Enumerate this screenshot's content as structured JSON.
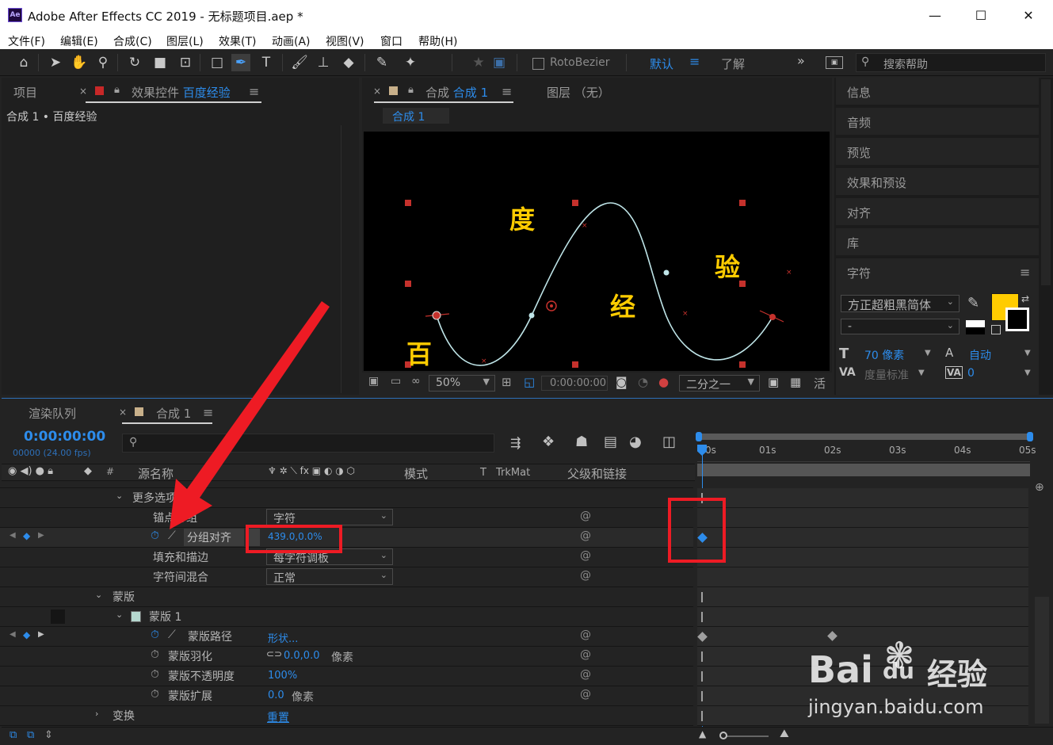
{
  "window": {
    "title": "Adobe After Effects CC 2019 - 无标题项目.aep *",
    "app_badge": "Ae",
    "minimize": "—",
    "maximize": "☐",
    "close": "✕"
  },
  "menu": [
    "文件(F)",
    "编辑(E)",
    "合成(C)",
    "图层(L)",
    "效果(T)",
    "动画(A)",
    "视图(V)",
    "窗口",
    "帮助(H)"
  ],
  "toolbar": {
    "rotobezier": "RotoBezier",
    "workspace_default": "默认",
    "workspace_learn": "了解",
    "more": "»",
    "search_placeholder": "搜索帮助"
  },
  "project_panel": {
    "tab_project": "项目",
    "tab_effects_prefix": "效果控件",
    "tab_effects_name": "百度经验",
    "breadcrumb": "合成 1 • 百度经验"
  },
  "comp_panel": {
    "tab_prefix": "合成",
    "tab_name": "合成 1",
    "tab_layer": "图层 （无）",
    "sub_tab": "合成 1",
    "zoom": "50%",
    "timecode": "0:00:00:00",
    "resolution": "二分之一",
    "trail": "活"
  },
  "viewer_text": {
    "char1": "百",
    "char2": "度",
    "char3": "经",
    "char4": "验"
  },
  "right_panels": [
    "信息",
    "音频",
    "预览",
    "效果和预设",
    "对齐",
    "库"
  ],
  "character_panel": {
    "title": "字符",
    "font": "方正超粗黑简体",
    "style": "-",
    "size_label": "70 像素",
    "leading": "自动",
    "tracking_label": "度量标准",
    "va_value": "0",
    "fill_color": "#ffcc00"
  },
  "timeline": {
    "tab_render": "渲染队列",
    "tab_comp": "合成 1",
    "timecode": "0:00:00:00",
    "frames": "00000 (24.00 fps)",
    "col_source": "源名称",
    "col_mode": "模式",
    "col_t": "T",
    "col_trkmat": "TrkMat",
    "col_parent": "父级和链接",
    "ruler": [
      "0s",
      "01s",
      "02s",
      "03s",
      "04s",
      "05s"
    ],
    "rows": [
      {
        "label": "更多选项"
      },
      {
        "label": "锚点分组",
        "value": "字符"
      },
      {
        "label": "分组对齐",
        "value": "439.0,0.0%"
      },
      {
        "label": "填充和描边",
        "value": "每字符调板"
      },
      {
        "label": "字符间混合",
        "value": "正常"
      },
      {
        "label": "蒙版"
      },
      {
        "label": "蒙版 1"
      },
      {
        "label": "蒙版路径",
        "value": "形状..."
      },
      {
        "label": "蒙版羽化",
        "value": "0.0,0.0",
        "unit": "像素"
      },
      {
        "label": "蒙版不透明度",
        "value": "100%"
      },
      {
        "label": "蒙版扩展",
        "value": "0.0",
        "unit": "像素"
      },
      {
        "label": "变换",
        "value": "重置"
      }
    ]
  },
  "watermark": {
    "brand": "Bai",
    "brand2": "du",
    "jingyan": "经验",
    "url": "jingyan.baidu.com"
  },
  "colors": {
    "accent": "#2d8ceb",
    "highlight_red": "#ee1b24",
    "viewer_text": "#ffcc00"
  }
}
